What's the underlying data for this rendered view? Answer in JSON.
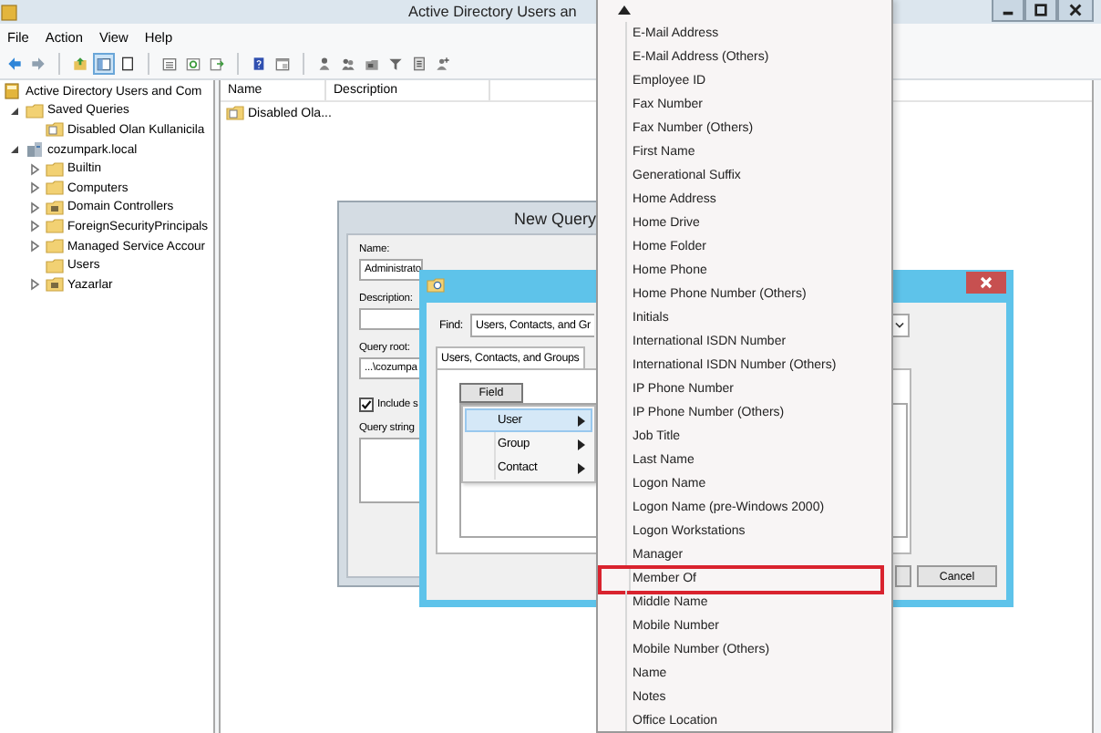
{
  "window": {
    "title": "Active Directory Users an"
  },
  "menu": [
    "File",
    "Action",
    "View",
    "Help"
  ],
  "toolbar": [
    {
      "kind": "back",
      "selected": false
    },
    {
      "kind": "forward",
      "selected": false
    },
    {
      "kind": "up",
      "selected": false
    },
    {
      "kind": "pane",
      "selected": true
    },
    {
      "kind": "sheet",
      "selected": false
    },
    {
      "kind": "list",
      "selected": false
    },
    {
      "kind": "refresh",
      "selected": false
    },
    {
      "kind": "export",
      "selected": false
    },
    {
      "kind": "help",
      "selected": false
    },
    {
      "kind": "console",
      "selected": false
    },
    {
      "kind": "user",
      "selected": false
    },
    {
      "kind": "group",
      "selected": false
    },
    {
      "kind": "ou",
      "selected": false
    },
    {
      "kind": "filter",
      "selected": false
    },
    {
      "kind": "query",
      "selected": false
    },
    {
      "kind": "addgroup",
      "selected": false
    }
  ],
  "tree": [
    {
      "label": "Active Directory Users and Com",
      "kind": "snapin",
      "children": [
        {
          "label": "Saved Queries",
          "kind": "folder",
          "expanded": true,
          "children": [
            {
              "label": "Disabled Olan Kullanicila",
              "kind": "query"
            }
          ]
        },
        {
          "label": "cozumpark.local",
          "kind": "domain",
          "expanded": true,
          "children": [
            {
              "label": "Builtin",
              "kind": "folder",
              "expanded": false
            },
            {
              "label": "Computers",
              "kind": "folder",
              "expanded": false
            },
            {
              "label": "Domain Controllers",
              "kind": "ou",
              "expanded": false
            },
            {
              "label": "ForeignSecurityPrincipals",
              "kind": "folder",
              "expanded": false
            },
            {
              "label": "Managed Service Accour",
              "kind": "folder",
              "expanded": false
            },
            {
              "label": "Users",
              "kind": "folder"
            },
            {
              "label": "Yazarlar",
              "kind": "ou",
              "expanded": false
            }
          ]
        }
      ]
    }
  ],
  "list": {
    "columns": [
      "Name",
      "Description"
    ],
    "rows": [
      {
        "name": "Disabled Ola...",
        "kind": "query"
      }
    ]
  },
  "new_query": {
    "title": "New Query",
    "name_label": "Name:",
    "name_value": "Administrato",
    "description_label": "Description:",
    "root_label": "Query root:",
    "root_value": "...\\cozumpa",
    "include_label": "Include s",
    "include_checked": true,
    "query_string_label": "Query string"
  },
  "find_dialog": {
    "find_label": "Find:",
    "find_value": "Users, Contacts, and Gr",
    "tab": "Users, Contacts, and Groups",
    "field_button": "Field",
    "cancel": "Cancel"
  },
  "field_menu": [
    {
      "label": "User",
      "selected": true
    },
    {
      "label": "Group",
      "selected": false
    },
    {
      "label": "Contact",
      "selected": false
    }
  ],
  "field_list": [
    {
      "label": "E-Mail Address",
      "selected": false
    },
    {
      "label": "E-Mail Address (Others)",
      "selected": false
    },
    {
      "label": "Employee ID",
      "selected": false
    },
    {
      "label": "Fax Number",
      "selected": false
    },
    {
      "label": "Fax Number (Others)",
      "selected": false
    },
    {
      "label": "First Name",
      "selected": false
    },
    {
      "label": "Generational Suffix",
      "selected": false
    },
    {
      "label": "Home Address",
      "selected": false
    },
    {
      "label": "Home Drive",
      "selected": false
    },
    {
      "label": "Home Folder",
      "selected": false
    },
    {
      "label": "Home Phone",
      "selected": false
    },
    {
      "label": "Home Phone Number (Others)",
      "selected": false
    },
    {
      "label": "Initials",
      "selected": false
    },
    {
      "label": "International ISDN Number",
      "selected": false
    },
    {
      "label": "International ISDN Number (Others)",
      "selected": false
    },
    {
      "label": "IP Phone Number",
      "selected": false
    },
    {
      "label": "IP Phone Number (Others)",
      "selected": false
    },
    {
      "label": "Job Title",
      "selected": false
    },
    {
      "label": "Last Name",
      "selected": false
    },
    {
      "label": "Logon Name",
      "selected": false
    },
    {
      "label": "Logon Name (pre-Windows 2000)",
      "selected": false
    },
    {
      "label": "Logon Workstations",
      "selected": false
    },
    {
      "label": "Manager",
      "selected": false
    },
    {
      "label": "Member Of",
      "selected": true
    },
    {
      "label": "Middle Name",
      "selected": false
    },
    {
      "label": "Mobile Number",
      "selected": false
    },
    {
      "label": "Mobile Number (Others)",
      "selected": false
    },
    {
      "label": "Name",
      "selected": false
    },
    {
      "label": "Notes",
      "selected": false
    },
    {
      "label": "Office Location",
      "selected": false
    }
  ]
}
